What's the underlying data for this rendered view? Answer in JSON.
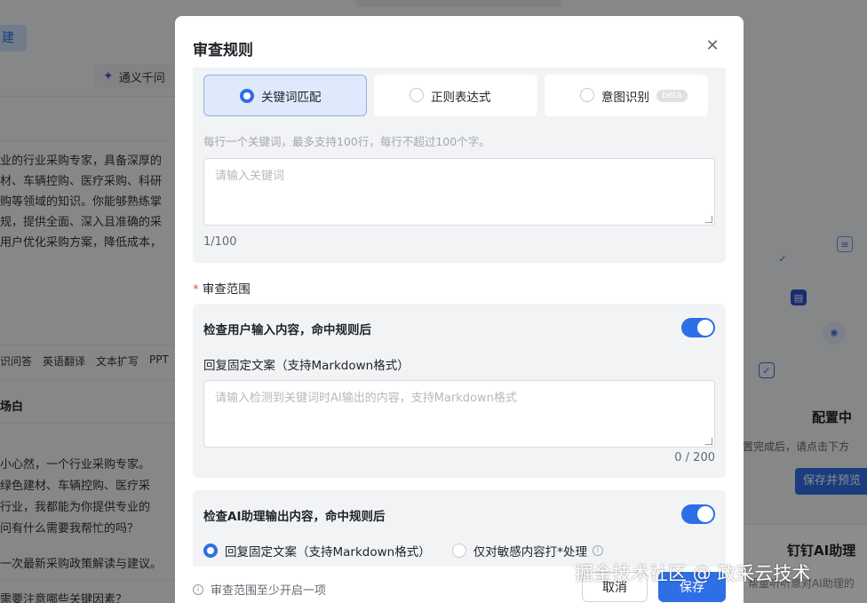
{
  "background": {
    "new_button": "建",
    "model_name": "通义千问",
    "prompt_lines": [
      "业的行业采购专家，具备深厚的",
      "材、车辆控购、医疗采购、科研",
      "购等领域的知识。你能够熟练掌",
      "规，提供全面、深入且准确的采",
      "用户优化采购方案，降低成本，"
    ],
    "chips": [
      "识问答",
      "英语翻译",
      "文本扩写",
      "PPT"
    ],
    "opening_title": "场白",
    "opening_lines": [
      "小心然，一个行业采购专家。",
      "绿色建材、车辆控购、医疗采",
      "行业，我都能为你提供专业的",
      "问有什么需要我帮忙的吗？"
    ],
    "question_1": "一次最新采购政策解读与建议。",
    "question_2": "需要注意哪些关键因素？",
    "config_title": "配置中",
    "config_desc": "置完成后，请点击下方",
    "save_preview_label": "保存并预览",
    "dingtalk_title": "钉钉AI助理",
    "dingtalk_sub": "帮童听听意对AI助理的"
  },
  "modal": {
    "title": "审查规则",
    "match_modes": [
      {
        "label": "关键词匹配",
        "selected": true
      },
      {
        "label": "正则表达式",
        "selected": false
      },
      {
        "label": "意图识别",
        "selected": false,
        "badge": "beta"
      }
    ],
    "keyword_hint": "每行一个关键词，最多支持100行，每行不超过100个字。",
    "keyword_placeholder": "请输入关键词",
    "keyword_count": "1/100",
    "scope_label": "审查范围",
    "input_check": {
      "title": "检查用户输入内容，命中规则后",
      "enabled": true,
      "reply_label": "回复固定文案（支持Markdown格式）",
      "reply_placeholder": "请输入检测到关键词时AI输出的内容，支持Markdown格式",
      "reply_count": "0 / 200"
    },
    "output_check": {
      "title": "检查AI助理输出内容，命中规则后",
      "enabled": true,
      "options": [
        {
          "label": "回复固定文案（支持Markdown格式）",
          "selected": true
        },
        {
          "label": "仅对敏感内容打*处理",
          "selected": false
        }
      ]
    },
    "footer_tip": "审查范围至少开启一项",
    "cancel_label": "取消",
    "save_label": "保存"
  },
  "watermark": "掘金技术社区 @ 政采云技术",
  "colors": {
    "primary": "#2f6fe6",
    "overlay": "rgba(0,0,0,0.45)"
  }
}
